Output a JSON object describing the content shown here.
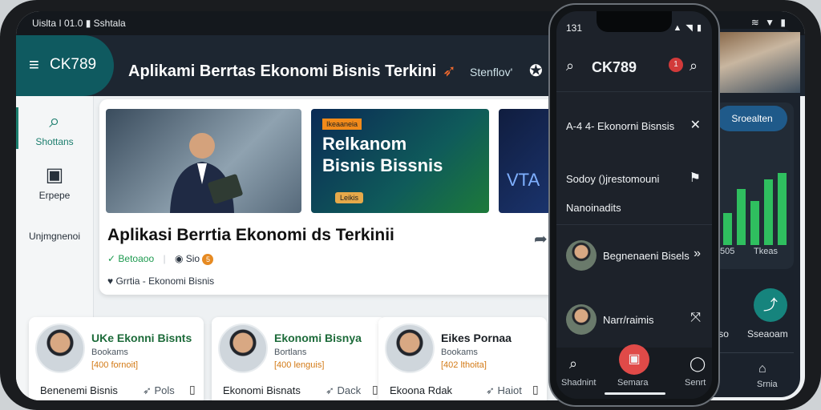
{
  "tablet": {
    "status": {
      "left": "Uislta I 01.0 ▮ Sshtala",
      "right": "≋ ▼ ▮"
    },
    "header": {
      "menu_icon": "menu-icon",
      "brand": "CK789",
      "title": "Aplikami Berrtas Ekonomi Bisnis Terkini",
      "action_label": "Stenflov'"
    },
    "rail": [
      {
        "label": "Shottans",
        "icon": "search-icon",
        "active": true
      },
      {
        "label": "Erpepe",
        "icon": "news-icon",
        "active": false
      },
      {
        "label": "Unjmgnenoi",
        "icon": "",
        "active": false
      }
    ],
    "hero": {
      "thumb2_badge": "Ikeaaneia",
      "thumb2_text": "Relkanom Bisnis Bissnis",
      "thumb2_chip": "Leikis",
      "thumb3_text": "VTA",
      "title": "Aplikasi Berrtia Ekonomi ds Terkinii",
      "status": "Betoaoo",
      "count": "Sio",
      "count_badge": "5",
      "category": "Grrtia - Ekonomi Bisnis"
    },
    "cards": [
      {
        "title": "UKe Ekonni Bisnts",
        "subtitle": "Bookams",
        "meta": "[400 fornoit]",
        "footer": "Benenemi Bisnis",
        "action": "Pols"
      },
      {
        "title": "Ekonomi Bisnya",
        "subtitle": "Bortlans",
        "meta": "[400 lenguis]",
        "footer": "Ekonomi Bisnats",
        "action": "Dack"
      },
      {
        "title": "Eikes Pornaa",
        "subtitle": "Bookams",
        "meta": "[402 lthoita]",
        "footer": "Ekoona Rdak",
        "action": "Haiot"
      }
    ]
  },
  "phone": {
    "time": "131",
    "signal": "▲ ◥ ▮",
    "brand": "CK789",
    "alert_count": "1",
    "items": [
      {
        "label": "A-4 4- Ekonorni Bisnsis",
        "right_icon": "close-icon"
      },
      {
        "label": "Sodoy ()jrestomouni",
        "right_icon": "bookmark-icon"
      },
      {
        "label": "Nanoinadits",
        "right_icon": ""
      },
      {
        "label": "Begnenaeni Bisels",
        "right_icon": "chevron-right-icon"
      },
      {
        "label": "Narr/raimis",
        "right_icon": "expand-icon"
      }
    ],
    "nav": [
      {
        "label": "Shadnint",
        "icon": "home-icon"
      },
      {
        "label": "Semara",
        "icon": "game-icon"
      },
      {
        "label": "Senrt",
        "icon": "profile-icon"
      }
    ]
  },
  "back_phone": {
    "pill": "Sroealten",
    "chart_labels": [
      "505",
      "Tkeas"
    ],
    "chart_data": {
      "type": "bar",
      "values": [
        40,
        70,
        55,
        82,
        90
      ]
    },
    "bottom_labels": [
      "'so",
      "Sseaoam"
    ],
    "nav_label": "Srnia"
  }
}
